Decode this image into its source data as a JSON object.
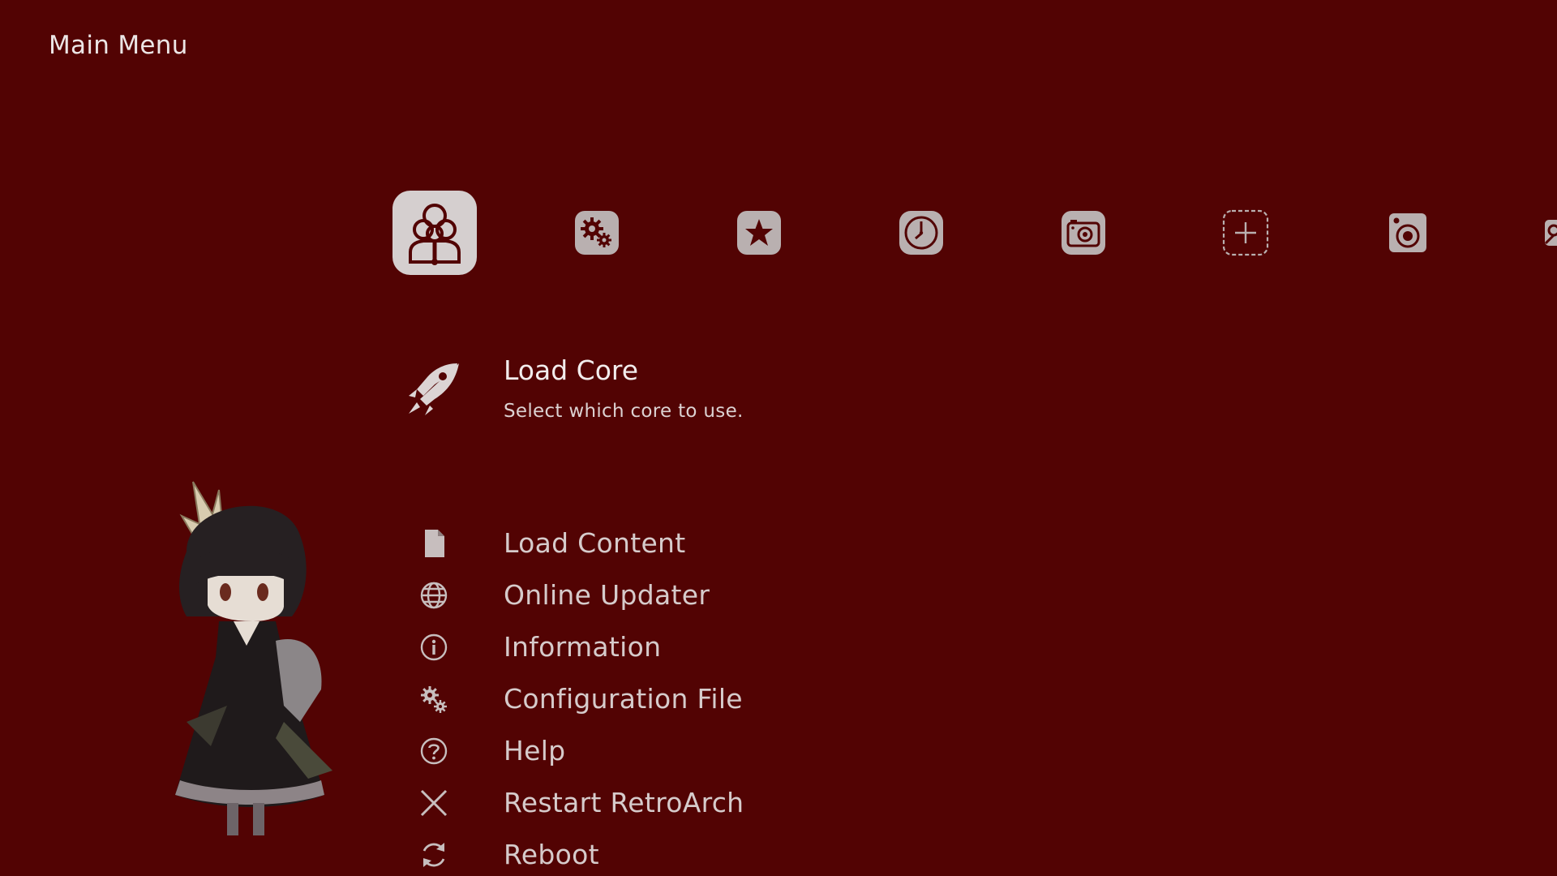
{
  "header": {
    "title": "Main Menu"
  },
  "colors": {
    "background": "#520303",
    "icon_fill": "#b9b0b0",
    "selected_icon_fill": "#d5cfcf",
    "text": "#e3dada"
  },
  "categories": [
    {
      "name": "main-menu",
      "icon": "main-menu-icon",
      "selected": true
    },
    {
      "name": "settings",
      "icon": "settings-gears-icon",
      "selected": false
    },
    {
      "name": "favorites",
      "icon": "star-icon",
      "selected": false
    },
    {
      "name": "history",
      "icon": "clock-icon",
      "selected": false
    },
    {
      "name": "images",
      "icon": "camera-icon",
      "selected": false
    },
    {
      "name": "add",
      "icon": "plus-icon",
      "selected": false
    },
    {
      "name": "music",
      "icon": "speaker-icon",
      "selected": false
    },
    {
      "name": "video",
      "icon": "video-icon",
      "selected": false
    }
  ],
  "selected_item": {
    "label": "Load Core",
    "sublabel": "Select which core to use.",
    "icon": "rocket-icon"
  },
  "menu": {
    "items": [
      {
        "label": "Load Content",
        "icon": "file-icon"
      },
      {
        "label": "Online Updater",
        "icon": "globe-icon"
      },
      {
        "label": "Information",
        "icon": "info-icon"
      },
      {
        "label": "Configuration File",
        "icon": "gears-icon"
      },
      {
        "label": "Help",
        "icon": "help-icon"
      },
      {
        "label": "Restart RetroArch",
        "icon": "close-icon"
      },
      {
        "label": "Reboot",
        "icon": "reboot-icon"
      }
    ]
  }
}
